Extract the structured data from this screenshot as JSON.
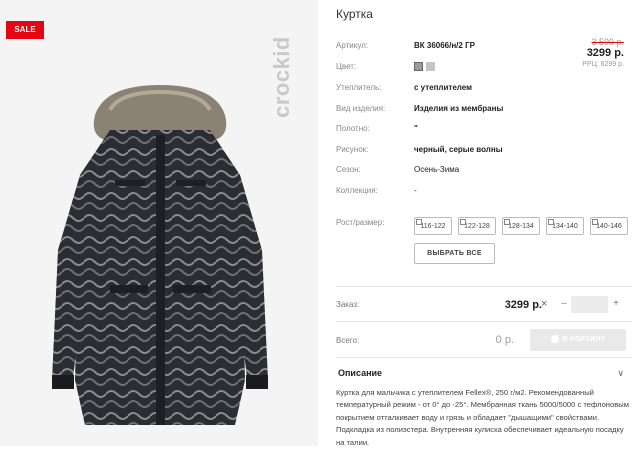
{
  "badge": {
    "sale": "SALE"
  },
  "brand": {
    "name": "crockid"
  },
  "product": {
    "title": "Куртка",
    "price_old": "3 599 р.",
    "price": "3299 р.",
    "rrp": "РРЦ: 6299 р."
  },
  "specs": [
    {
      "label": "Артикул:",
      "value": "ВК 36066/н/2 ГР",
      "bold": true
    },
    {
      "label": "Цвет:",
      "value": "",
      "bold": false
    },
    {
      "label": "Утеплитель:",
      "value": "с утеплителем",
      "bold": true
    },
    {
      "label": "Вид изделия:",
      "value": "Изделия из мембраны",
      "bold": true
    },
    {
      "label": "Полотно:",
      "value": "\"",
      "bold": true
    },
    {
      "label": "Рисунок:",
      "value": "черный, серые волны",
      "bold": true
    },
    {
      "label": "Сезон:",
      "value": "Осень-Зима",
      "bold": false
    },
    {
      "label": "Коллекция:",
      "value": "-",
      "bold": false
    }
  ],
  "colors": [
    "#9a9a9a",
    "#c4c4c4"
  ],
  "sizes": {
    "label": "Рост/размер:",
    "options": [
      "116-122",
      "122-128",
      "128-134",
      "134-140",
      "140-146"
    ],
    "select_all": "ВЫБРАТЬ ВСЕ"
  },
  "order": {
    "label": "Заказ:",
    "price": "3299 р.",
    "remove": "×",
    "minus": "−",
    "plus": "+",
    "quantity": ""
  },
  "total": {
    "label": "Всего:",
    "price": "0 р.",
    "cart_button": "В КОРЗИНУ"
  },
  "description": {
    "heading": "Описание",
    "arrow": "∨",
    "text": "Куртка для мальчика с утеплителем Fellex®, 250 г/м2. Рекомендованный температурный режим - от 0° до -25°. Мембранная ткань 5000/5000 с тефлоновым покрытием отталкивает воду и грязь и обладает \"дышащими\" свойствами. Подкладка из полиэстера. Внутренняя кулиска обеспечивает идеальную посадку на талии."
  },
  "accent_colors": {
    "sale": "#e30613",
    "background_left": "#f4f4f4"
  }
}
